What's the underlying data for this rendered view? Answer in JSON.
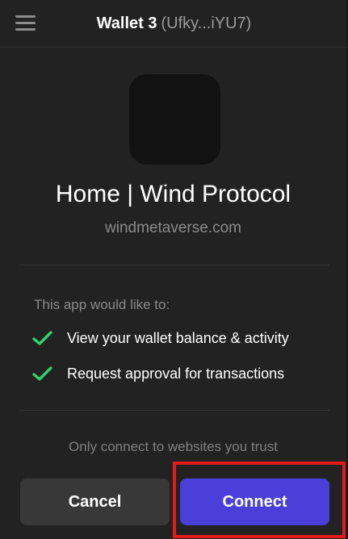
{
  "header": {
    "menu_icon": "hamburger-menu-icon",
    "wallet_name": "Wallet 3",
    "wallet_address": "(Ufky...iYU7)"
  },
  "site": {
    "title": "Home | Wind Protocol",
    "url": "windmetaverse.com"
  },
  "permissions": {
    "heading": "This app would like to:",
    "items": [
      {
        "label": "View your wallet balance & activity",
        "icon": "check-icon"
      },
      {
        "label": "Request approval for transactions",
        "icon": "check-icon"
      }
    ]
  },
  "footer": {
    "trust_note": "Only connect to websites you trust",
    "cancel_label": "Cancel",
    "connect_label": "Connect"
  },
  "colors": {
    "background": "#222222",
    "accent": "#4a3fd8",
    "check": "#2fd36b",
    "highlight": "#e31b1b"
  }
}
